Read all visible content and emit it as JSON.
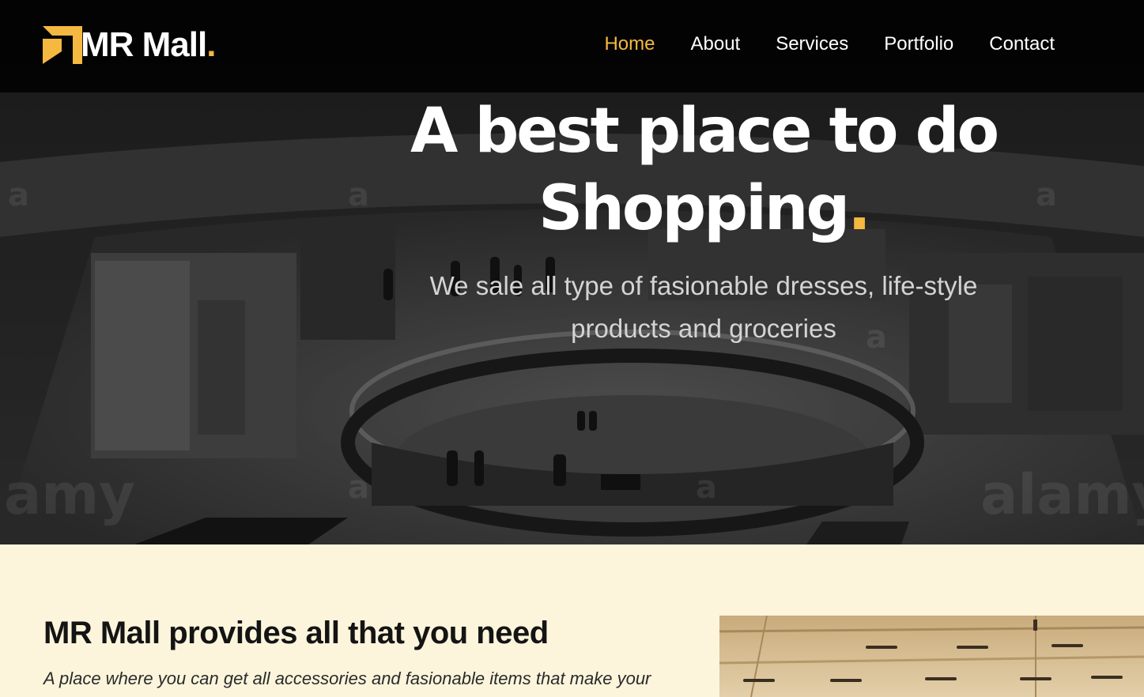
{
  "brand": {
    "name": "MR Mall",
    "dot": ".",
    "accent_color": "#f5b841"
  },
  "nav": {
    "items": [
      {
        "label": "Home",
        "active": true
      },
      {
        "label": "About",
        "active": false
      },
      {
        "label": "Services",
        "active": false
      },
      {
        "label": "Portfolio",
        "active": false
      },
      {
        "label": "Contact",
        "active": false
      }
    ]
  },
  "hero": {
    "title_line1": "A best place to do",
    "title_line2": "Shopping",
    "title_dot": ".",
    "subtitle": "We sale all type of fasionable dresses, life-style products and groceries",
    "background_image": "shopping-mall-photo",
    "watermark": "alamy"
  },
  "about": {
    "title": "MR Mall provides all that you need",
    "description": "A place where you can get all accessories and fasionable items that make your",
    "image": "mall-ceiling-photo"
  }
}
